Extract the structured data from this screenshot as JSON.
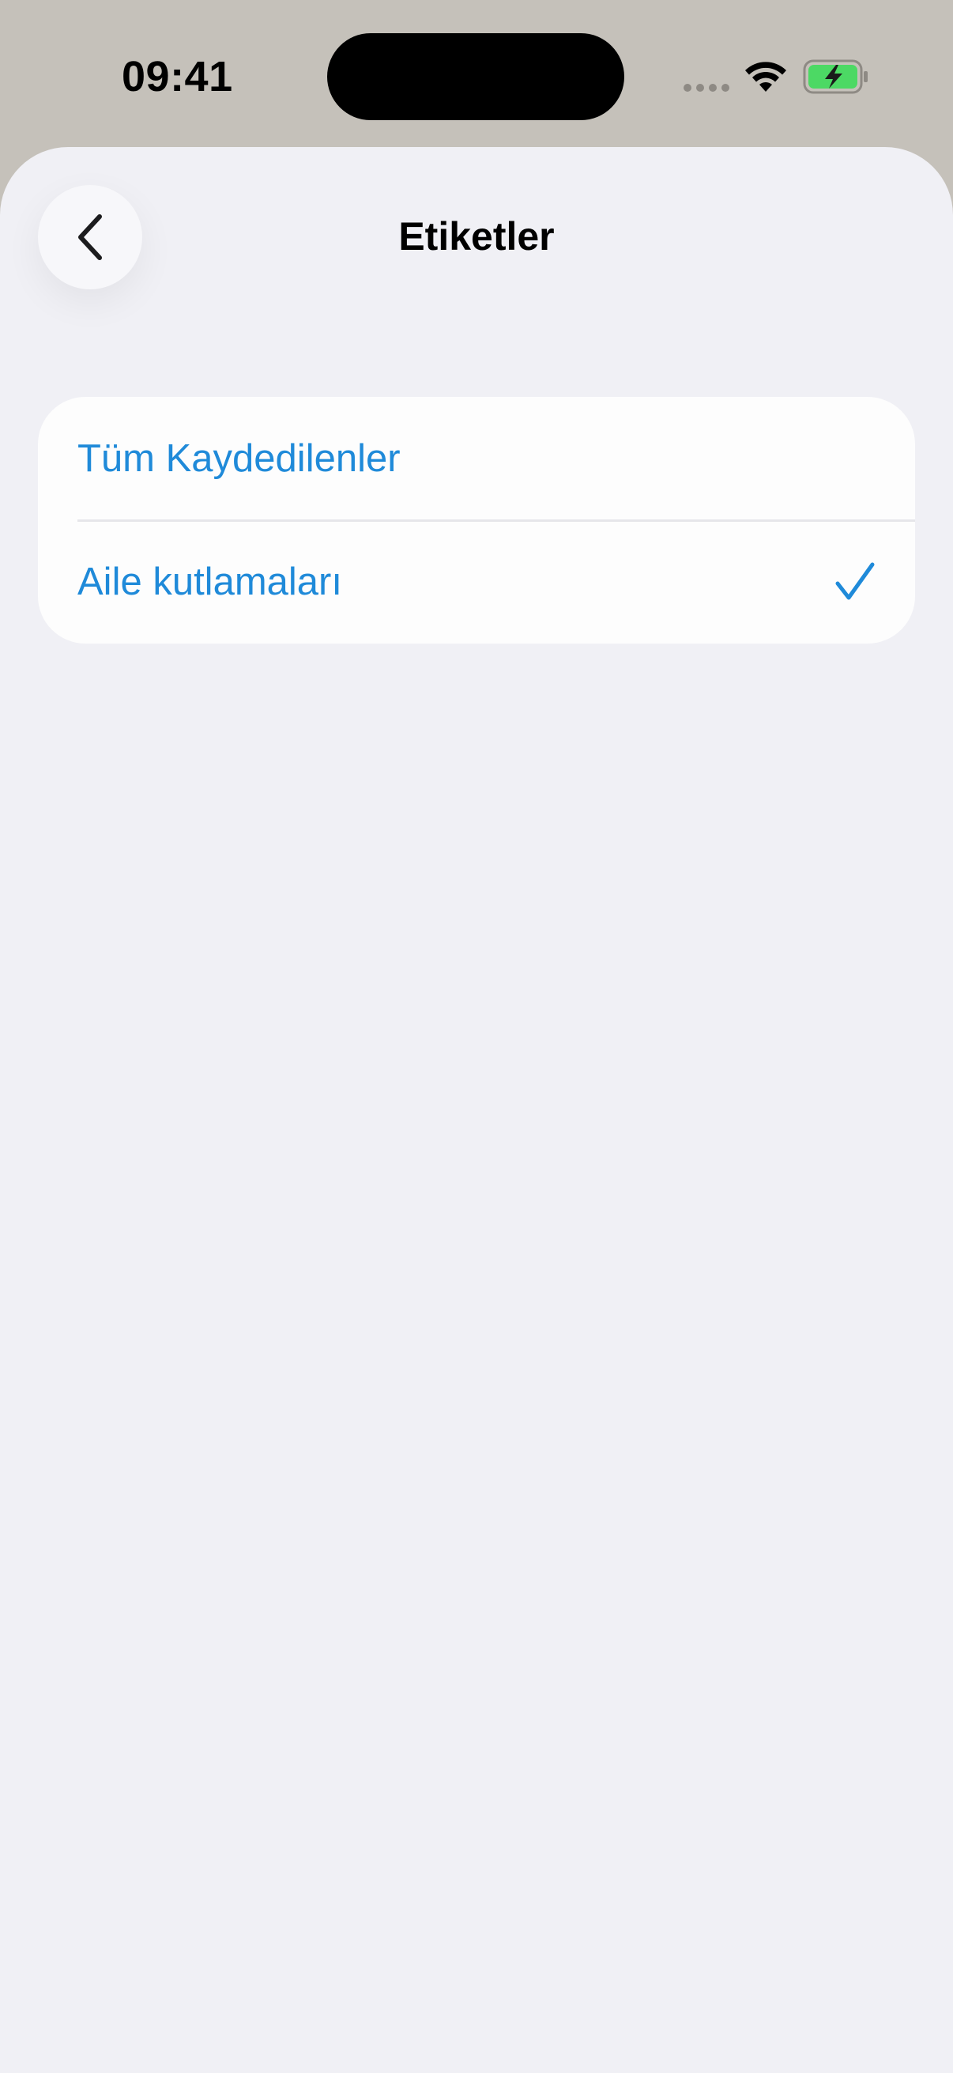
{
  "status_bar": {
    "time": "09:41",
    "icons": [
      "cellular-dots-icon",
      "wifi-icon",
      "battery-charging-icon"
    ],
    "battery_color": "#4cd964"
  },
  "sheet": {
    "title": "Etiketler",
    "back_icon": "chevron-left-icon"
  },
  "list": {
    "accent_color": "#1f8ad9",
    "items": [
      {
        "label": "Tüm Kaydedilenler",
        "selected": false
      },
      {
        "label": "Aile kutlamaları",
        "selected": true,
        "check_icon": "checkmark-icon"
      }
    ]
  }
}
